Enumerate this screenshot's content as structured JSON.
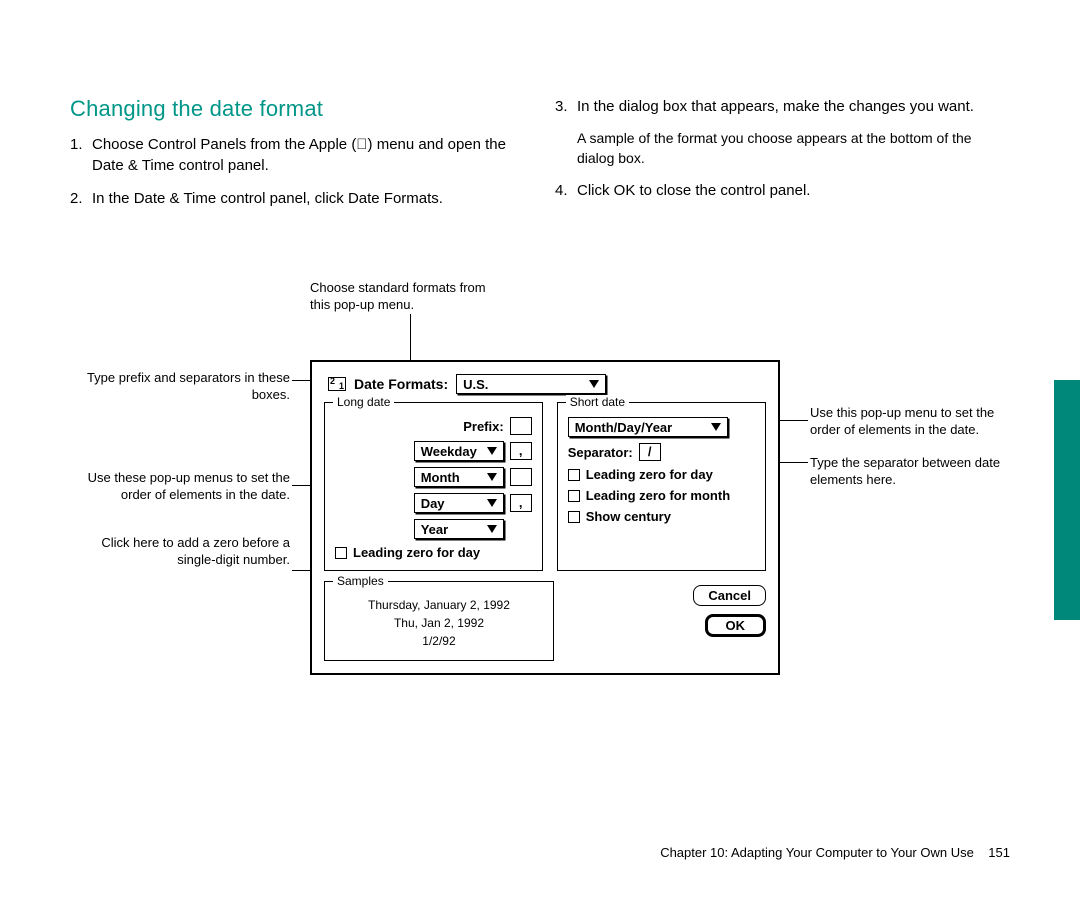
{
  "title": "Changing the date format",
  "steps": {
    "s1_num": "1.",
    "s1": "Choose Control Panels from the Apple () menu and open the Date & Time control panel.",
    "s2_num": "2.",
    "s2": "In the Date & Time control panel, click Date Formats.",
    "s3_num": "3.",
    "s3": "In the dialog box that appears, make the changes you want.",
    "s3_sub": "A sample of the format you choose appears at the bottom of the dialog box.",
    "s4_num": "4.",
    "s4": "Click OK to close the control panel."
  },
  "callouts": {
    "c_top": "Choose standard formats from this pop-up menu.",
    "c_prefix": "Type prefix and separators in these boxes.",
    "c_leftmenus": "Use these pop-up menus to set the order of elements in the date.",
    "c_zero": "Click here to add a zero before a single-digit number.",
    "c_rightmenu": "Use this pop-up menu to set the order of elements in the date.",
    "c_septype": "Type the separator between date elements here."
  },
  "dialog": {
    "title": "Date Formats:",
    "region": "U.S.",
    "long_legend": "Long date",
    "short_legend": "Short date",
    "prefix_label": "Prefix:",
    "prefix_value": "",
    "elem1": "Weekday",
    "sep1": ",",
    "elem2": "Month",
    "sep2": "",
    "elem3": "Day",
    "sep3": ",",
    "elem4": "Year",
    "long_cb": "Leading zero for day",
    "short_order": "Month/Day/Year",
    "sep_label": "Separator:",
    "sep_value": "/",
    "short_cb1": "Leading zero for day",
    "short_cb2": "Leading zero for month",
    "short_cb3": "Show century",
    "samples_legend": "Samples",
    "sample1": "Thursday, January 2, 1992",
    "sample2": "Thu, Jan 2, 1992",
    "sample3": "1/2/92",
    "cancel": "Cancel",
    "ok": "OK"
  },
  "footer": {
    "chapter": "Chapter 10:  Adapting Your Computer to Your Own Use",
    "page": "151"
  }
}
